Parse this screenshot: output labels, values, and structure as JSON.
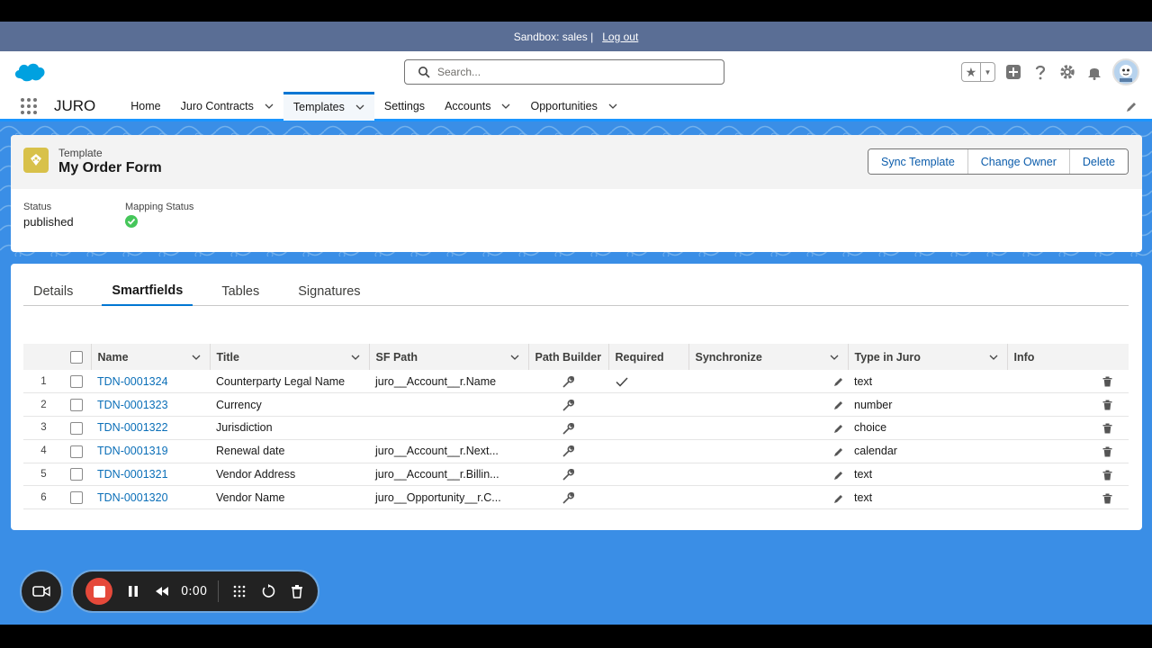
{
  "sandbox": {
    "label": "Sandbox: sales |",
    "logout": "Log out"
  },
  "search": {
    "placeholder": "Search..."
  },
  "app": {
    "name": "JURO"
  },
  "nav": [
    {
      "label": "Home",
      "dropdown": false,
      "active": false
    },
    {
      "label": "Juro Contracts",
      "dropdown": true,
      "active": false
    },
    {
      "label": "Templates",
      "dropdown": true,
      "active": true
    },
    {
      "label": "Settings",
      "dropdown": false,
      "active": false
    },
    {
      "label": "Accounts",
      "dropdown": true,
      "active": false
    },
    {
      "label": "Opportunities",
      "dropdown": true,
      "active": false
    }
  ],
  "record": {
    "type": "Template",
    "name": "My Order Form",
    "actions": [
      "Sync Template",
      "Change Owner",
      "Delete"
    ],
    "fields": [
      {
        "label": "Status",
        "value": "published"
      },
      {
        "label": "Mapping Status",
        "value": ""
      }
    ]
  },
  "tabs": [
    {
      "label": "Details",
      "active": false
    },
    {
      "label": "Smartfields",
      "active": true
    },
    {
      "label": "Tables",
      "active": false
    },
    {
      "label": "Signatures",
      "active": false
    }
  ],
  "table": {
    "columns": [
      "Name",
      "Title",
      "SF Path",
      "Path Builder",
      "Required",
      "Synchronize",
      "Type in Juro",
      "Info"
    ],
    "rows": [
      {
        "num": "1",
        "name": "TDN-0001324",
        "title": "Counterparty Legal Name",
        "path": "juro__Account__r.Name",
        "required": true,
        "type": "text"
      },
      {
        "num": "2",
        "name": "TDN-0001323",
        "title": "Currency",
        "path": "",
        "required": false,
        "type": "number"
      },
      {
        "num": "3",
        "name": "TDN-0001322",
        "title": "Jurisdiction",
        "path": "",
        "required": false,
        "type": "choice"
      },
      {
        "num": "4",
        "name": "TDN-0001319",
        "title": "Renewal date",
        "path": "juro__Account__r.Next...",
        "required": false,
        "type": "calendar"
      },
      {
        "num": "5",
        "name": "TDN-0001321",
        "title": "Vendor Address",
        "path": "juro__Account__r.Billin...",
        "required": false,
        "type": "text"
      },
      {
        "num": "6",
        "name": "TDN-0001320",
        "title": "Vendor Name",
        "path": "juro__Opportunity__r.C...",
        "required": false,
        "type": "text"
      }
    ]
  },
  "recorder": {
    "time": "0:00"
  },
  "colors": {
    "brand": "#0176d3",
    "sandbox_bar": "#5a6e95",
    "background": "#3a8ee6",
    "record_stop": "#e5493a",
    "template_icon": "#d8c14a",
    "success": "#2e844a"
  }
}
